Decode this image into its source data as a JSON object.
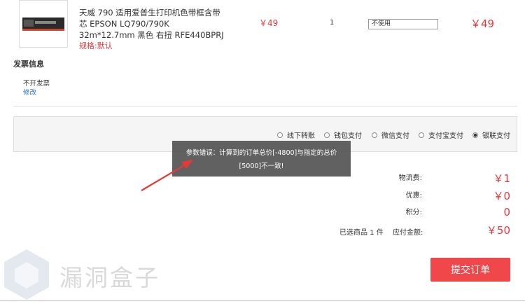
{
  "product": {
    "name": "天威 790 适用爱普生打印机色带框含带芯 EPSON LQ790/790K 32m*12.7mm 黑色 右扭 RFE440BPRJ",
    "spec": "规格:默认",
    "unit_price": "￥49",
    "quantity": "1",
    "coupon_selected": "不使用",
    "subtotal": "￥49"
  },
  "invoice": {
    "title": "发票信息",
    "value": "不开发票",
    "modify_label": "修改"
  },
  "payment": {
    "options": [
      {
        "label": "线下转账",
        "selected": false
      },
      {
        "label": "钱包支付",
        "selected": false
      },
      {
        "label": "微信支付",
        "selected": false
      },
      {
        "label": "支付宝支付",
        "selected": false
      },
      {
        "label": "银联支付",
        "selected": true
      }
    ]
  },
  "toast": {
    "message": "参数错误：计算到的订单总价[-4800]与指定的总价[5000]不一致!"
  },
  "summary": {
    "shipping_label": "物流费:",
    "shipping_value": "￥1",
    "discount_label": "优惠:",
    "discount_value": "￥0",
    "points_label": "积分:",
    "points_value": "0",
    "selected_count": "已选商品 1 件",
    "payable_label": "应付金额:",
    "payable_value": "￥50"
  },
  "submit_label": "提交订单",
  "watermark": "漏洞盒子",
  "colors": {
    "price": "#e4393c",
    "submit_bg": "#f0474a",
    "link": "#2a6ebd",
    "toast_bg": "#505050"
  }
}
